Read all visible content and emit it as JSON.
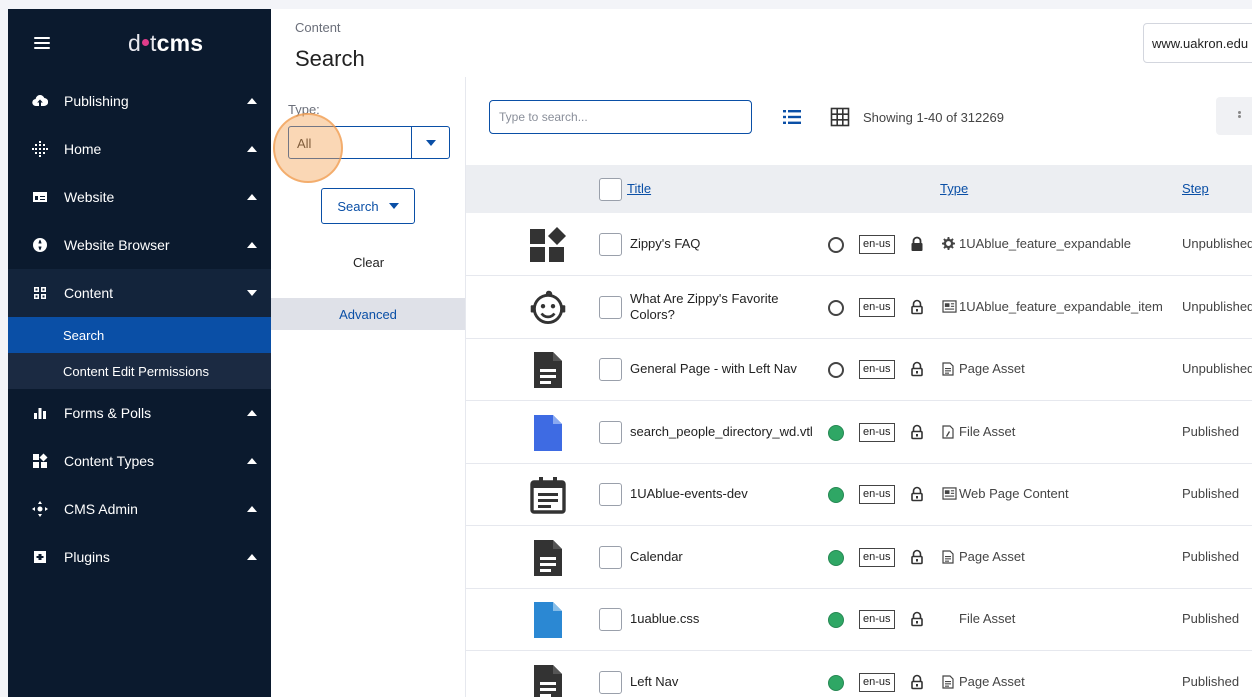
{
  "sidebar": {
    "logo": {
      "part1": "d",
      "part2": "t",
      "part3": "cms"
    },
    "items": [
      {
        "label": "Publishing",
        "icon": "cloud-upload-icon"
      },
      {
        "label": "Home",
        "icon": "home-grid-icon"
      },
      {
        "label": "Website",
        "icon": "window-icon"
      },
      {
        "label": "Website Browser",
        "icon": "globe-icon"
      },
      {
        "label": "Content",
        "icon": "grid-icon"
      },
      {
        "label": "Forms & Polls",
        "icon": "bar-chart-icon"
      },
      {
        "label": "Content Types",
        "icon": "blocks-icon"
      },
      {
        "label": "CMS Admin",
        "icon": "hub-icon"
      },
      {
        "label": "Plugins",
        "icon": "plugin-icon"
      }
    ],
    "content_sub": [
      {
        "label": "Search"
      },
      {
        "label": "Content Edit Permissions"
      }
    ]
  },
  "header": {
    "breadcrumb": "Content",
    "title": "Search",
    "site": "www.uakron.edu"
  },
  "filters": {
    "type_label": "Type:",
    "type_value": "All",
    "search_label": "Search",
    "clear_label": "Clear",
    "advanced_label": "Advanced"
  },
  "main": {
    "search_placeholder": "Type to search...",
    "showing": "Showing 1-40 of 312269",
    "columns": {
      "title": "Title",
      "type": "Type",
      "step": "Step"
    },
    "rows": [
      {
        "title": "Zippy's FAQ",
        "status": "unpublished",
        "lang": "en-us",
        "locked": true,
        "type": "1UAblue_feature_expandable",
        "type_icon": "gear-icon",
        "step": "Unpublished",
        "thumb": "blocks-icon"
      },
      {
        "title": "What Are Zippy's Favorite Colors?",
        "status": "unpublished",
        "lang": "en-us",
        "locked": false,
        "type": "1UAblue_feature_expandable_item",
        "type_icon": "newspaper-icon",
        "step": "Unpublished",
        "thumb": "smiley-icon"
      },
      {
        "title": "General Page - with Left Nav",
        "status": "unpublished",
        "lang": "en-us",
        "locked": false,
        "type": "Page Asset",
        "type_icon": "document-icon",
        "step": "Unpublished",
        "thumb": "page-icon"
      },
      {
        "title": "search_people_directory_wd.vtl",
        "status": "published",
        "lang": "en-us",
        "locked": false,
        "type": "File Asset",
        "type_icon": "file-icon",
        "step": "Published",
        "thumb": "blue-file-icon"
      },
      {
        "title": "1UAblue-events-dev",
        "status": "published",
        "lang": "en-us",
        "locked": false,
        "type": "Web Page Content",
        "type_icon": "newspaper-icon",
        "step": "Published",
        "thumb": "calendar-icon"
      },
      {
        "title": "Calendar",
        "status": "published",
        "lang": "en-us",
        "locked": false,
        "type": "Page Asset",
        "type_icon": "document-icon",
        "step": "Published",
        "thumb": "page-icon"
      },
      {
        "title": "1uablue.css",
        "status": "published",
        "lang": "en-us",
        "locked": false,
        "type": "File Asset",
        "type_icon": "",
        "step": "Published",
        "thumb": "light-blue-file-icon"
      },
      {
        "title": "Left Nav",
        "status": "published",
        "lang": "en-us",
        "locked": false,
        "type": "Page Asset",
        "type_icon": "document-icon",
        "step": "Published",
        "thumb": "page-icon"
      }
    ]
  },
  "colors": {
    "sidebar_bg": "#0b1a2e",
    "accent": "#0a4fa6",
    "published": "#2fa765",
    "highlight": "#f5a65a"
  }
}
